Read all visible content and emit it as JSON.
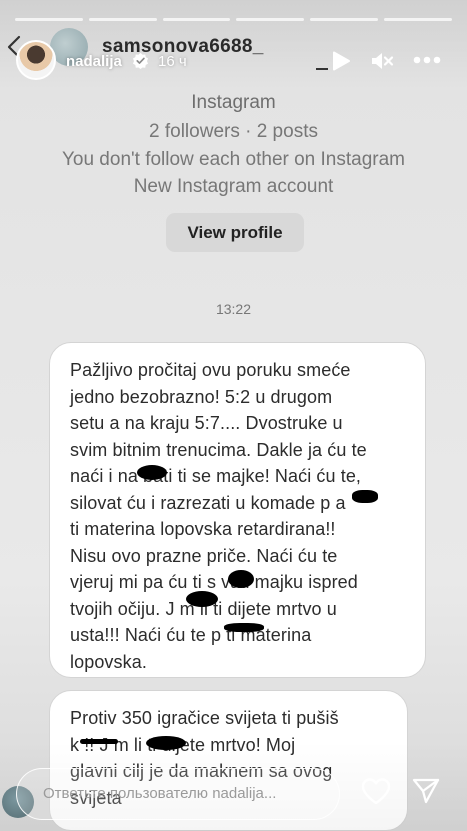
{
  "story": {
    "progress_segments": 6,
    "author": "nadalija",
    "time_ago": "16 ч",
    "reply_placeholder": "Ответьте пользователю nadalija..."
  },
  "dm": {
    "username": "samsonova6688_"
  },
  "profile": {
    "name": "Instagram",
    "stats": "2 followers · 2 posts",
    "follow_status": "You don't follow each other on Instagram",
    "note": "New Instagram account",
    "view_profile_label": "View profile"
  },
  "chat": {
    "timestamp": "13:22",
    "messages": [
      {
        "text": "Pažljivo pročitaj ovu poruku smeće\njedno bezobrazno! 5:2 u drugom\nsetu a na kraju 5:7.... Dvostruke u\nsvim bitnim trenucima. Dakle ja ću te\nnaći i na  bati ti se majke! Naći ću te,\nsilovat ću i razrezati u komade p   a\nti materina lopovska retardirana!!\nNisu ovo prazne priče. Naći ću te\nvjeruj mi pa ću ti s   vati majku ispred\ntvojih očiju. J    m li ti dijete mrtvo u\nusta!!! Naći ću te p    ti materina\nlopovska."
      },
      {
        "text": "Protiv 350 igračice svijeta ti pušiš\nk    !! J    m li ti dijete mrtvo! Moj\nglavni cilj je da maknem sa ovog\nsvijeta"
      }
    ]
  },
  "colors": {
    "background": "#e4e4e4",
    "bubble": "#ffffff",
    "text_dark": "#2c2c2c",
    "text_muted": "#777777",
    "button": "#d8d8d8"
  },
  "icons": [
    "back-icon",
    "verified-icon",
    "play-icon",
    "mute-icon",
    "more-icon",
    "heart-icon",
    "send-icon"
  ]
}
